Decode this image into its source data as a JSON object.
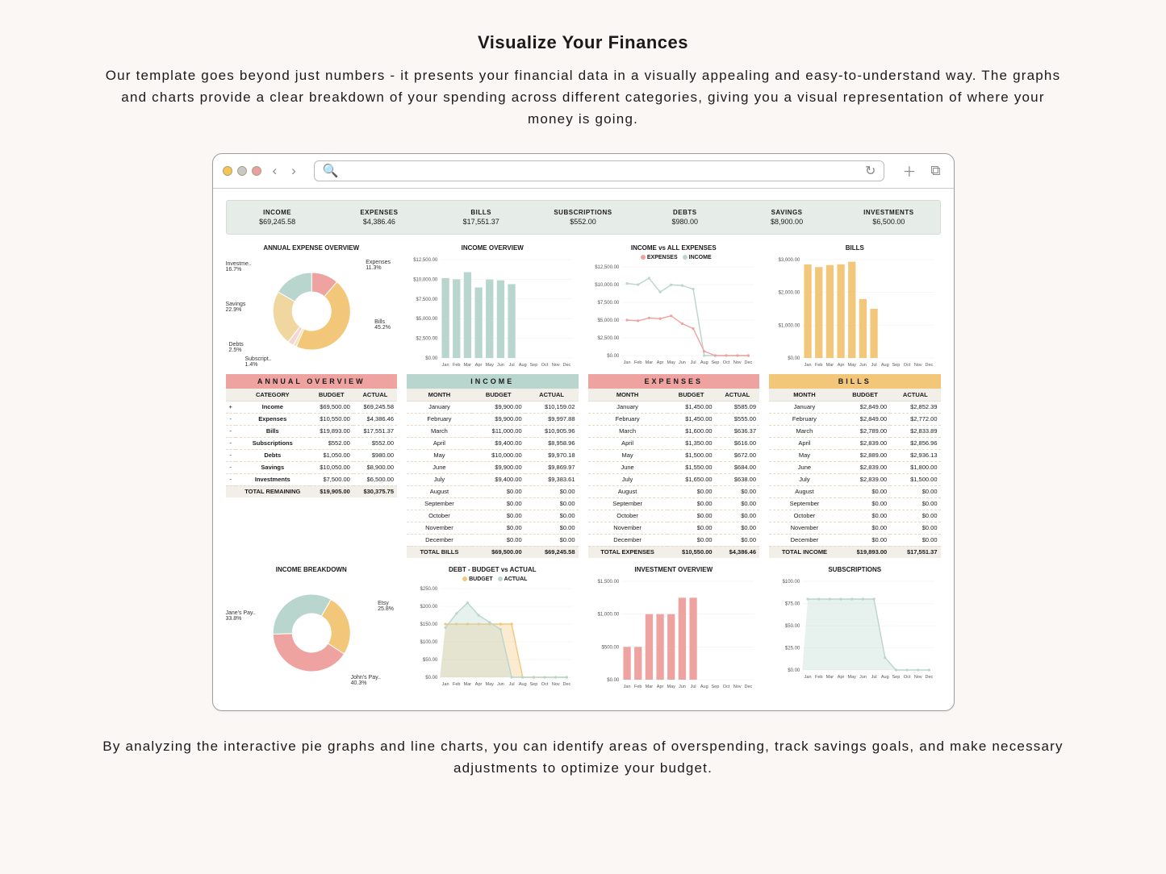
{
  "hero": {
    "title": "Visualize Your Finances",
    "sub": "Our template goes beyond just numbers - it presents your financial data in a visually appealing and easy-to-understand way. The graphs and charts provide a clear breakdown of your spending across different categories, giving you a visual representation of where your money is going.",
    "footer": "By analyzing the interactive pie graphs and line charts, you can identify areas of overspending, track savings goals, and make necessary adjustments to optimize your budget."
  },
  "kpi": [
    {
      "label": "INCOME",
      "value": "$69,245.58"
    },
    {
      "label": "EXPENSES",
      "value": "$4,386.46"
    },
    {
      "label": "BILLS",
      "value": "$17,551.37"
    },
    {
      "label": "SUBSCRIPTIONS",
      "value": "$552.00"
    },
    {
      "label": "DEBTS",
      "value": "$980.00"
    },
    {
      "label": "SAVINGS",
      "value": "$8,900.00"
    },
    {
      "label": "INVESTMENTS",
      "value": "$6,500.00"
    }
  ],
  "titles": {
    "annual_expense": "ANNUAL EXPENSE OVERVIEW",
    "income_overview": "INCOME OVERVIEW",
    "income_vs": "INCOME vs ALL EXPENSES",
    "bills": "BILLS",
    "income_breakdown": "INCOME BREAKDOWN",
    "debt": "DEBT - BUDGET vs ACTUAL",
    "investment": "INVESTMENT OVERVIEW",
    "subs": "SUBSCRIPTIONS"
  },
  "legend": {
    "expenses": "EXPENSES",
    "income": "INCOME",
    "budget": "BUDGET",
    "actual": "ACTUAL"
  },
  "months": [
    "Jan",
    "Feb",
    "Mar",
    "Apr",
    "May",
    "Jun",
    "Jul",
    "Aug",
    "Sep",
    "Oct",
    "Nov",
    "Dec"
  ],
  "donut_expense": [
    {
      "name": "Expenses",
      "pct": "11.3%"
    },
    {
      "name": "Bills",
      "pct": "45.2%"
    },
    {
      "name": "Subscript..",
      "pct": "1.4%"
    },
    {
      "name": "Debts",
      "pct": "2.5%"
    },
    {
      "name": "Savings",
      "pct": "22.9%"
    },
    {
      "name": "Investme..",
      "pct": "16.7%"
    }
  ],
  "donut_income": [
    {
      "name": "Etsy",
      "pct": "25.8%"
    },
    {
      "name": "John's Pay..",
      "pct": "40.3%"
    },
    {
      "name": "Jane's Pay..",
      "pct": "33.8%"
    }
  ],
  "annual_overview": {
    "header": "ANNUAL OVERVIEW",
    "cols": [
      "CATEGORY",
      "BUDGET",
      "ACTUAL"
    ],
    "rows": [
      [
        "+",
        "Income",
        "$69,500.00",
        "$69,245.58"
      ],
      [
        "-",
        "Expenses",
        "$10,550.00",
        "$4,386.46"
      ],
      [
        "-",
        "Bills",
        "$19,893.00",
        "$17,551.37"
      ],
      [
        "-",
        "Subscriptions",
        "$552.00",
        "$552.00"
      ],
      [
        "-",
        "Debts",
        "$1,050.00",
        "$980.00"
      ],
      [
        "-",
        "Savings",
        "$10,050.00",
        "$8,900.00"
      ],
      [
        "-",
        "Investments",
        "$7,500.00",
        "$6,500.00"
      ]
    ],
    "total": [
      "TOTAL REMAINING",
      "$19,905.00",
      "$30,375.75"
    ]
  },
  "tables_month_cols": [
    "MONTH",
    "BUDGET",
    "ACTUAL"
  ],
  "income_table": {
    "header": "INCOME",
    "rows": [
      [
        "January",
        "$9,900.00",
        "$10,159.02"
      ],
      [
        "February",
        "$9,900.00",
        "$9,997.88"
      ],
      [
        "March",
        "$11,000.00",
        "$10,905.96"
      ],
      [
        "April",
        "$9,400.00",
        "$8,958.96"
      ],
      [
        "May",
        "$10,000.00",
        "$9,970.18"
      ],
      [
        "June",
        "$9,900.00",
        "$9,869.97"
      ],
      [
        "July",
        "$9,400.00",
        "$9,383.61"
      ],
      [
        "August",
        "$0.00",
        "$0.00"
      ],
      [
        "September",
        "$0.00",
        "$0.00"
      ],
      [
        "October",
        "$0.00",
        "$0.00"
      ],
      [
        "November",
        "$0.00",
        "$0.00"
      ],
      [
        "December",
        "$0.00",
        "$0.00"
      ]
    ],
    "total": [
      "TOTAL BILLS",
      "$69,500.00",
      "$69,245.58"
    ]
  },
  "expenses_table": {
    "header": "EXPENSES",
    "rows": [
      [
        "January",
        "$1,450.00",
        "$585.09"
      ],
      [
        "February",
        "$1,450.00",
        "$555.00"
      ],
      [
        "March",
        "$1,600.00",
        "$636.37"
      ],
      [
        "April",
        "$1,350.00",
        "$616.00"
      ],
      [
        "May",
        "$1,500.00",
        "$672.00"
      ],
      [
        "June",
        "$1,550.00",
        "$684.00"
      ],
      [
        "July",
        "$1,650.00",
        "$638.00"
      ],
      [
        "August",
        "$0.00",
        "$0.00"
      ],
      [
        "September",
        "$0.00",
        "$0.00"
      ],
      [
        "October",
        "$0.00",
        "$0.00"
      ],
      [
        "November",
        "$0.00",
        "$0.00"
      ],
      [
        "December",
        "$0.00",
        "$0.00"
      ]
    ],
    "total": [
      "TOTAL EXPENSES",
      "$10,550.00",
      "$4,386.46"
    ]
  },
  "bills_table": {
    "header": "BILLS",
    "rows": [
      [
        "January",
        "$2,849.00",
        "$2,852.39"
      ],
      [
        "February",
        "$2,849.00",
        "$2,772.00"
      ],
      [
        "March",
        "$2,789.00",
        "$2,833.89"
      ],
      [
        "April",
        "$2,839.00",
        "$2,856.96"
      ],
      [
        "May",
        "$2,889.00",
        "$2,936.13"
      ],
      [
        "June",
        "$2,839.00",
        "$1,800.00"
      ],
      [
        "July",
        "$2,839.00",
        "$1,500.00"
      ],
      [
        "August",
        "$0.00",
        "$0.00"
      ],
      [
        "September",
        "$0.00",
        "$0.00"
      ],
      [
        "October",
        "$0.00",
        "$0.00"
      ],
      [
        "November",
        "$0.00",
        "$0.00"
      ],
      [
        "December",
        "$0.00",
        "$0.00"
      ]
    ],
    "total": [
      "TOTAL INCOME",
      "$19,893.00",
      "$17,551.37"
    ]
  },
  "chart_data": [
    {
      "type": "pie",
      "title": "ANNUAL EXPENSE OVERVIEW",
      "series": [
        {
          "name": "Expenses",
          "value": 11.3
        },
        {
          "name": "Bills",
          "value": 45.2
        },
        {
          "name": "Subscriptions",
          "value": 1.4
        },
        {
          "name": "Debts",
          "value": 2.5
        },
        {
          "name": "Savings",
          "value": 22.9
        },
        {
          "name": "Investments",
          "value": 16.7
        }
      ]
    },
    {
      "type": "bar",
      "title": "INCOME OVERVIEW",
      "categories": [
        "Jan",
        "Feb",
        "Mar",
        "Apr",
        "May",
        "Jun",
        "Jul",
        "Aug",
        "Sep",
        "Oct",
        "Nov",
        "Dec"
      ],
      "values": [
        10159,
        9998,
        10906,
        8959,
        9970,
        9870,
        9384,
        0,
        0,
        0,
        0,
        0
      ],
      "ylim": [
        0,
        12500
      ],
      "yticks": [
        "$0.00",
        "$2,500.00",
        "$5,000.00",
        "$7,500.00",
        "$10,000.00",
        "$12,500.00"
      ]
    },
    {
      "type": "line",
      "title": "INCOME vs ALL EXPENSES",
      "categories": [
        "Jan",
        "Feb",
        "Mar",
        "Apr",
        "May",
        "Jun",
        "Jul",
        "Aug",
        "Sep",
        "Oct",
        "Nov",
        "Dec"
      ],
      "series": [
        {
          "name": "INCOME",
          "values": [
            10159,
            9998,
            10906,
            8959,
            9970,
            9870,
            9384,
            0,
            0,
            0,
            0,
            0
          ]
        },
        {
          "name": "EXPENSES",
          "values": [
            5000,
            4900,
            5300,
            5200,
            5600,
            4500,
            3800,
            600,
            0,
            0,
            0,
            0
          ]
        }
      ],
      "ylim": [
        0,
        12500
      ],
      "yticks": [
        "$0.00",
        "$2,500.00",
        "$5,000.00",
        "$7,500.00",
        "$10,000.00",
        "$12,500.00"
      ]
    },
    {
      "type": "bar",
      "title": "BILLS",
      "categories": [
        "Jan",
        "Feb",
        "Mar",
        "Apr",
        "May",
        "Jun",
        "Jul",
        "Aug",
        "Sep",
        "Oct",
        "Nov",
        "Dec"
      ],
      "values": [
        2852,
        2772,
        2834,
        2857,
        2936,
        1800,
        1500,
        0,
        0,
        0,
        0,
        0
      ],
      "ylim": [
        0,
        3000
      ],
      "yticks": [
        "$0.00",
        "$1,000.00",
        "$2,000.00",
        "$3,000.00"
      ]
    },
    {
      "type": "pie",
      "title": "INCOME BREAKDOWN",
      "series": [
        {
          "name": "Etsy",
          "value": 25.8
        },
        {
          "name": "John's Pay",
          "value": 40.3
        },
        {
          "name": "Jane's Pay",
          "value": 33.8
        }
      ]
    },
    {
      "type": "area",
      "title": "DEBT - BUDGET vs ACTUAL",
      "categories": [
        "Jan",
        "Feb",
        "Mar",
        "Apr",
        "May",
        "Jun",
        "Jul",
        "Aug",
        "Sep",
        "Oct",
        "Nov",
        "Dec"
      ],
      "series": [
        {
          "name": "BUDGET",
          "values": [
            150,
            150,
            150,
            150,
            150,
            150,
            150,
            0,
            0,
            0,
            0,
            0
          ]
        },
        {
          "name": "ACTUAL",
          "values": [
            140,
            180,
            210,
            175,
            155,
            135,
            0,
            0,
            0,
            0,
            0,
            0
          ]
        }
      ],
      "ylim": [
        0,
        250
      ],
      "yticks": [
        "$0.00",
        "$50.00",
        "$100.00",
        "$150.00",
        "$200.00",
        "$250.00"
      ]
    },
    {
      "type": "bar",
      "title": "INVESTMENT OVERVIEW",
      "categories": [
        "Jan",
        "Feb",
        "Mar",
        "Apr",
        "May",
        "Jun",
        "Jul",
        "Aug",
        "Sep",
        "Oct",
        "Nov",
        "Dec"
      ],
      "values": [
        500,
        500,
        1000,
        1000,
        1000,
        1250,
        1250,
        0,
        0,
        0,
        0,
        0
      ],
      "ylim": [
        0,
        1500
      ],
      "yticks": [
        "$0.00",
        "$500.00",
        "$1,000.00",
        "$1,500.00"
      ]
    },
    {
      "type": "area",
      "title": "SUBSCRIPTIONS",
      "categories": [
        "Jan",
        "Feb",
        "Mar",
        "Apr",
        "May",
        "Jun",
        "Jul",
        "Aug",
        "Sep",
        "Oct",
        "Nov",
        "Dec"
      ],
      "values": [
        80,
        80,
        80,
        80,
        80,
        80,
        80,
        14,
        0,
        0,
        0,
        0
      ],
      "ylim": [
        0,
        100
      ],
      "yticks": [
        "$0.00",
        "$25.00",
        "$50.00",
        "$75.00",
        "$100.00"
      ]
    }
  ]
}
